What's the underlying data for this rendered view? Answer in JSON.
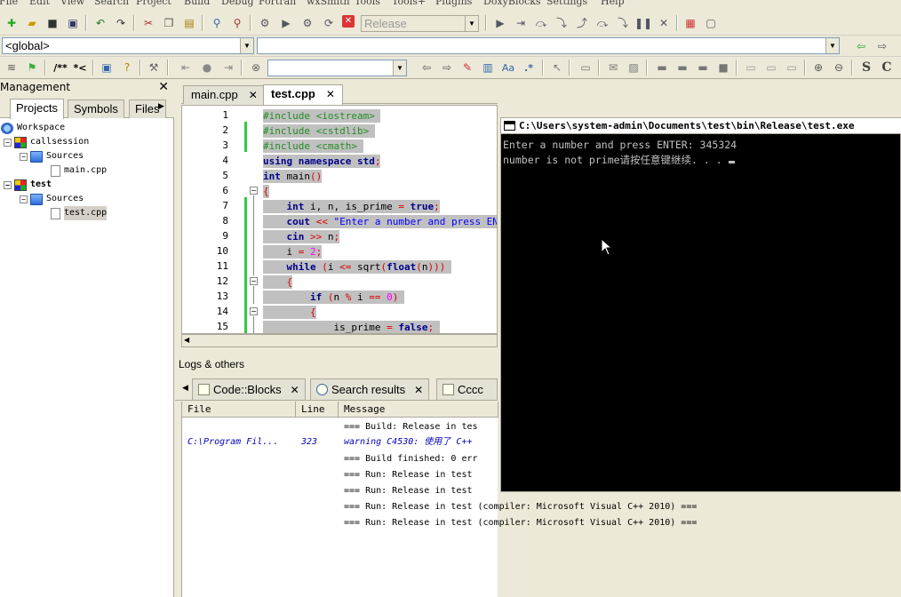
{
  "menu": [
    "File",
    "Edit",
    "View",
    "Search",
    "Project",
    "Build",
    "Debug",
    "Fortran",
    "wxSmith",
    "Tools",
    "Tools+",
    "Plugins",
    "DoxyBlocks",
    "Settings",
    "Help"
  ],
  "toolbar": {
    "build_target": "Release",
    "scope_combo": "<global>",
    "symbol_combo": "",
    "doc_comment": "/**",
    "doc_inline": "*<",
    "regex_icon": ".*",
    "case_label": "Aa"
  },
  "management": {
    "title": "Management",
    "tabs": [
      "Projects",
      "Symbols",
      "Files"
    ],
    "tree": {
      "workspace": "Workspace",
      "projects": [
        {
          "name": "callsession",
          "folder": "Sources",
          "file": "main.cpp"
        },
        {
          "name": "test",
          "folder": "Sources",
          "file": "test.cpp"
        }
      ]
    }
  },
  "editor": {
    "tabs": [
      {
        "label": "main.cpp"
      },
      {
        "label": "test.cpp"
      }
    ],
    "line_numbers": [
      "1",
      "2",
      "3",
      "4",
      "5",
      "6",
      "7",
      "8",
      "9",
      "10",
      "11",
      "12",
      "13",
      "14",
      "15"
    ]
  },
  "logs": {
    "title": "Logs & others",
    "tabs": [
      "Code::Blocks",
      "Search results",
      "Cccc"
    ],
    "columns": [
      "File",
      "Line",
      "Message"
    ],
    "rows": [
      {
        "file": "",
        "line": "",
        "message": "=== Build: Release in tes"
      },
      {
        "file": "C:\\Program Fil...",
        "line": "323",
        "message": "warning C4530: 使用了 C++"
      },
      {
        "file": "",
        "line": "",
        "message": "=== Build finished: 0 err"
      },
      {
        "file": "",
        "line": "",
        "message": "=== Run: Release in test"
      },
      {
        "file": "",
        "line": "",
        "message": "=== Run: Release in test"
      },
      {
        "file": "",
        "line": "",
        "message": "=== Run: Release in test (compiler: Microsoft Visual C++ 2010) ==="
      },
      {
        "file": "",
        "line": "",
        "message": "=== Run: Release in test (compiler: Microsoft Visual C++ 2010) ==="
      }
    ]
  },
  "console": {
    "title": "C:\\Users\\system-admin\\Documents\\test\\bin\\Release\\test.exe",
    "lines": [
      "Enter a number and press ENTER: 345324",
      "number is not prime请按任意键继续. . . "
    ]
  }
}
